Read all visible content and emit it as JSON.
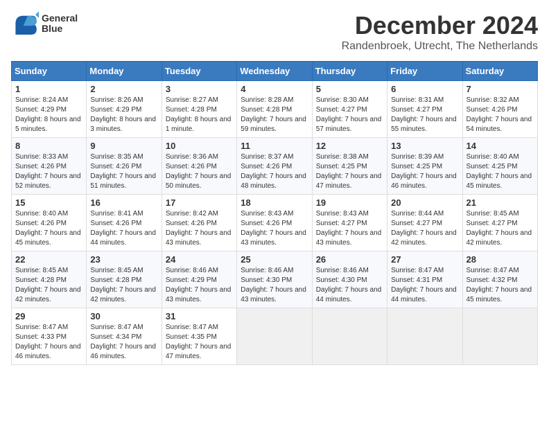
{
  "header": {
    "logo_line1": "General",
    "logo_line2": "Blue",
    "month": "December 2024",
    "location": "Randenbroek, Utrecht, The Netherlands"
  },
  "weekdays": [
    "Sunday",
    "Monday",
    "Tuesday",
    "Wednesday",
    "Thursday",
    "Friday",
    "Saturday"
  ],
  "weeks": [
    [
      {
        "day": "1",
        "rise": "Sunrise: 8:24 AM",
        "set": "Sunset: 4:29 PM",
        "daylight": "Daylight: 8 hours and 5 minutes."
      },
      {
        "day": "2",
        "rise": "Sunrise: 8:26 AM",
        "set": "Sunset: 4:29 PM",
        "daylight": "Daylight: 8 hours and 3 minutes."
      },
      {
        "day": "3",
        "rise": "Sunrise: 8:27 AM",
        "set": "Sunset: 4:28 PM",
        "daylight": "Daylight: 8 hours and 1 minute."
      },
      {
        "day": "4",
        "rise": "Sunrise: 8:28 AM",
        "set": "Sunset: 4:28 PM",
        "daylight": "Daylight: 7 hours and 59 minutes."
      },
      {
        "day": "5",
        "rise": "Sunrise: 8:30 AM",
        "set": "Sunset: 4:27 PM",
        "daylight": "Daylight: 7 hours and 57 minutes."
      },
      {
        "day": "6",
        "rise": "Sunrise: 8:31 AM",
        "set": "Sunset: 4:27 PM",
        "daylight": "Daylight: 7 hours and 55 minutes."
      },
      {
        "day": "7",
        "rise": "Sunrise: 8:32 AM",
        "set": "Sunset: 4:26 PM",
        "daylight": "Daylight: 7 hours and 54 minutes."
      }
    ],
    [
      {
        "day": "8",
        "rise": "Sunrise: 8:33 AM",
        "set": "Sunset: 4:26 PM",
        "daylight": "Daylight: 7 hours and 52 minutes."
      },
      {
        "day": "9",
        "rise": "Sunrise: 8:35 AM",
        "set": "Sunset: 4:26 PM",
        "daylight": "Daylight: 7 hours and 51 minutes."
      },
      {
        "day": "10",
        "rise": "Sunrise: 8:36 AM",
        "set": "Sunset: 4:26 PM",
        "daylight": "Daylight: 7 hours and 50 minutes."
      },
      {
        "day": "11",
        "rise": "Sunrise: 8:37 AM",
        "set": "Sunset: 4:26 PM",
        "daylight": "Daylight: 7 hours and 48 minutes."
      },
      {
        "day": "12",
        "rise": "Sunrise: 8:38 AM",
        "set": "Sunset: 4:25 PM",
        "daylight": "Daylight: 7 hours and 47 minutes."
      },
      {
        "day": "13",
        "rise": "Sunrise: 8:39 AM",
        "set": "Sunset: 4:25 PM",
        "daylight": "Daylight: 7 hours and 46 minutes."
      },
      {
        "day": "14",
        "rise": "Sunrise: 8:40 AM",
        "set": "Sunset: 4:25 PM",
        "daylight": "Daylight: 7 hours and 45 minutes."
      }
    ],
    [
      {
        "day": "15",
        "rise": "Sunrise: 8:40 AM",
        "set": "Sunset: 4:26 PM",
        "daylight": "Daylight: 7 hours and 45 minutes."
      },
      {
        "day": "16",
        "rise": "Sunrise: 8:41 AM",
        "set": "Sunset: 4:26 PM",
        "daylight": "Daylight: 7 hours and 44 minutes."
      },
      {
        "day": "17",
        "rise": "Sunrise: 8:42 AM",
        "set": "Sunset: 4:26 PM",
        "daylight": "Daylight: 7 hours and 43 minutes."
      },
      {
        "day": "18",
        "rise": "Sunrise: 8:43 AM",
        "set": "Sunset: 4:26 PM",
        "daylight": "Daylight: 7 hours and 43 minutes."
      },
      {
        "day": "19",
        "rise": "Sunrise: 8:43 AM",
        "set": "Sunset: 4:27 PM",
        "daylight": "Daylight: 7 hours and 43 minutes."
      },
      {
        "day": "20",
        "rise": "Sunrise: 8:44 AM",
        "set": "Sunset: 4:27 PM",
        "daylight": "Daylight: 7 hours and 42 minutes."
      },
      {
        "day": "21",
        "rise": "Sunrise: 8:45 AM",
        "set": "Sunset: 4:27 PM",
        "daylight": "Daylight: 7 hours and 42 minutes."
      }
    ],
    [
      {
        "day": "22",
        "rise": "Sunrise: 8:45 AM",
        "set": "Sunset: 4:28 PM",
        "daylight": "Daylight: 7 hours and 42 minutes."
      },
      {
        "day": "23",
        "rise": "Sunrise: 8:45 AM",
        "set": "Sunset: 4:28 PM",
        "daylight": "Daylight: 7 hours and 42 minutes."
      },
      {
        "day": "24",
        "rise": "Sunrise: 8:46 AM",
        "set": "Sunset: 4:29 PM",
        "daylight": "Daylight: 7 hours and 43 minutes."
      },
      {
        "day": "25",
        "rise": "Sunrise: 8:46 AM",
        "set": "Sunset: 4:30 PM",
        "daylight": "Daylight: 7 hours and 43 minutes."
      },
      {
        "day": "26",
        "rise": "Sunrise: 8:46 AM",
        "set": "Sunset: 4:30 PM",
        "daylight": "Daylight: 7 hours and 44 minutes."
      },
      {
        "day": "27",
        "rise": "Sunrise: 8:47 AM",
        "set": "Sunset: 4:31 PM",
        "daylight": "Daylight: 7 hours and 44 minutes."
      },
      {
        "day": "28",
        "rise": "Sunrise: 8:47 AM",
        "set": "Sunset: 4:32 PM",
        "daylight": "Daylight: 7 hours and 45 minutes."
      }
    ],
    [
      {
        "day": "29",
        "rise": "Sunrise: 8:47 AM",
        "set": "Sunset: 4:33 PM",
        "daylight": "Daylight: 7 hours and 46 minutes."
      },
      {
        "day": "30",
        "rise": "Sunrise: 8:47 AM",
        "set": "Sunset: 4:34 PM",
        "daylight": "Daylight: 7 hours and 46 minutes."
      },
      {
        "day": "31",
        "rise": "Sunrise: 8:47 AM",
        "set": "Sunset: 4:35 PM",
        "daylight": "Daylight: 7 hours and 47 minutes."
      },
      null,
      null,
      null,
      null
    ]
  ]
}
